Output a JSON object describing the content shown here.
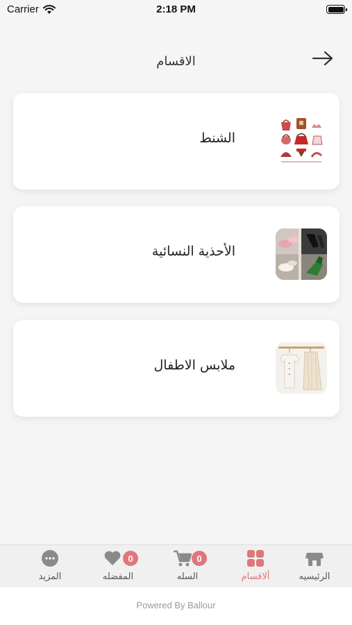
{
  "status_bar": {
    "carrier": "Carrier",
    "time": "2:18 PM"
  },
  "header": {
    "title": "الاقسام"
  },
  "categories": [
    {
      "label": "الشنط",
      "thumb_icon": "bags-collage-image"
    },
    {
      "label": "الأحذية النسائية",
      "thumb_icon": "womens-shoes-image"
    },
    {
      "label": "ملابس الاطفال",
      "thumb_icon": "kids-clothes-image"
    }
  ],
  "tabbar": {
    "tabs": [
      {
        "label": "الرئيسيه",
        "icon": "store-icon",
        "active": false
      },
      {
        "label": "ألاقسام",
        "icon": "grid-icon",
        "active": true
      },
      {
        "label": "السله",
        "icon": "cart-icon",
        "badge": "0",
        "active": false
      },
      {
        "label": "المفضله",
        "icon": "heart-icon",
        "badge": "0",
        "active": false
      },
      {
        "label": "المزيد",
        "icon": "more-icon",
        "active": false
      }
    ]
  },
  "footer": {
    "powered_by": "Powered By Ballour"
  },
  "colors": {
    "accent": "#e0767b",
    "icon_gray": "#8a8a8a",
    "background": "#f4f5f4"
  }
}
